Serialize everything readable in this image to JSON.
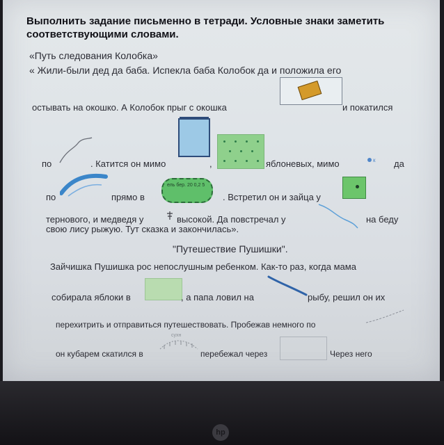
{
  "header": {
    "line1": "Выполнить задание письменно в тетради. Условные знаки заметить",
    "line2": "соответствующими словами."
  },
  "story1": {
    "title": "«Путь следования Колобка»",
    "l1": "« Жили-были дед да баба. Испекла баба Колобок да и положила его",
    "l2a": "остывать на окошко. А Колобок прыг с окошка",
    "l2b": "и покатился",
    "l3a": "по",
    "l3b": ". Катится он мимо",
    "l3c": ",",
    "l3d": "яблоневых, мимо",
    "l3e": "да",
    "l4a": "по",
    "l4b": "прямо в",
    "l4c": ". Встретил он и зайца у",
    "l5a": "тернового, и медведя у",
    "l5b": "высокой. Да повстречал у",
    "l5c": "на беду",
    "l6": "свою лису рыжую. Тут сказка и закончилась»."
  },
  "story2": {
    "title": "\"Путешествие Пушишки\".",
    "l1": "Зайчишка Пушишка рос непослушным ребенком. Как-то раз, когда мама",
    "l2a": "собирала яблоки в",
    "l2b": ", а папа ловил на",
    "l2c": "рыбу, решил он их",
    "l3": "перехитрить и отправиться путешествовать. Пробежав немного по",
    "l4a": "он кубарем скатился в",
    "l4b": "перебежал через",
    "l4c": "Через него"
  },
  "symbols": {
    "forest_sign": "ель бер. 20 0,2 5",
    "ravine_sign": "сухн"
  },
  "colors": {
    "water_blue": "#3b86c9",
    "meadow_green": "#7cc47a",
    "text": "#2b2b33"
  }
}
